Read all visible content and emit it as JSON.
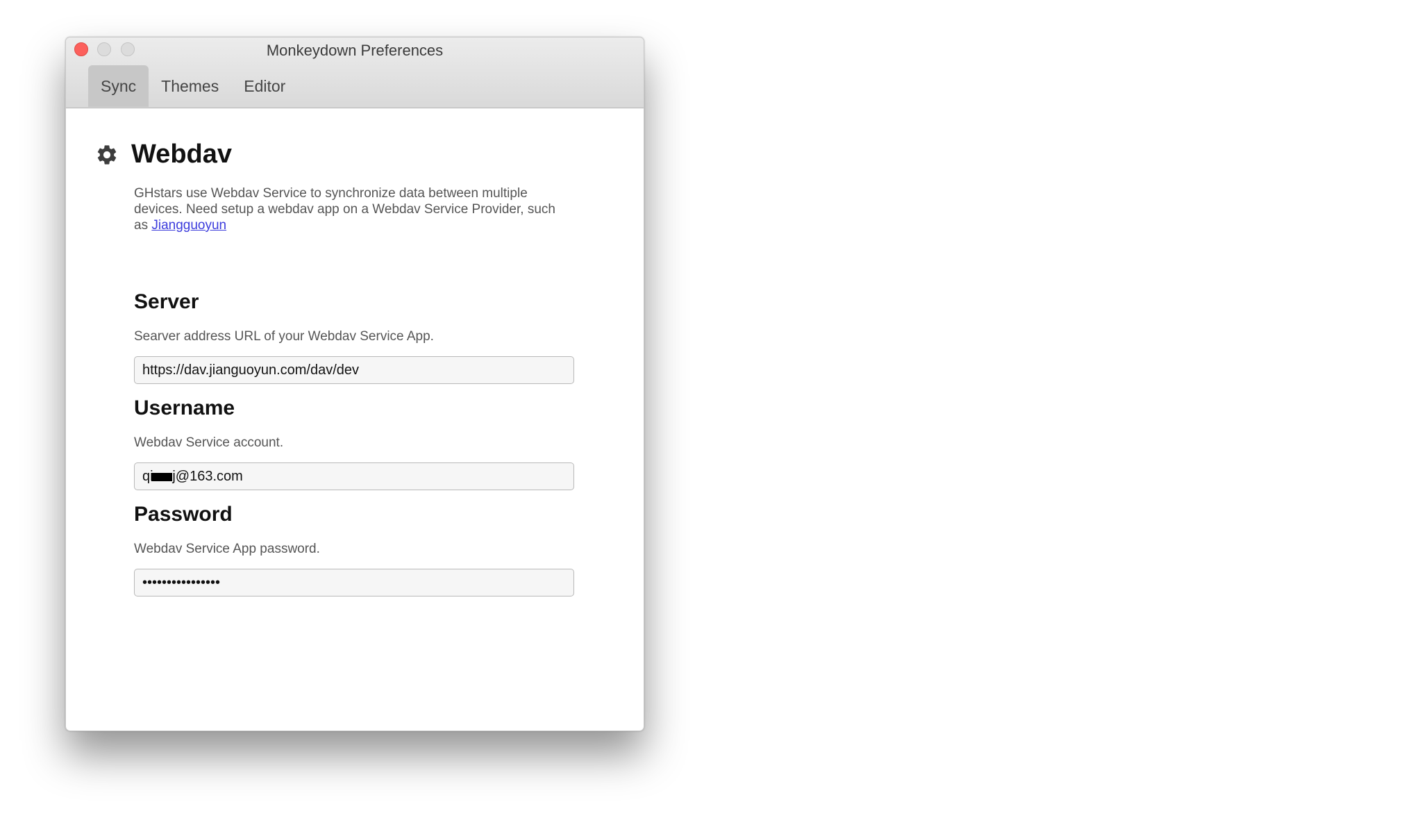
{
  "window": {
    "title": "Monkeydown Preferences"
  },
  "tabs": [
    {
      "label": "Sync",
      "active": true
    },
    {
      "label": "Themes",
      "active": false
    },
    {
      "label": "Editor",
      "active": false
    }
  ],
  "section": {
    "icon": "gear-icon",
    "title": "Webdav",
    "description": "GHstars use Webdav Service to synchronize data between multiple devices. Need setup a webdav app on a Webdav Service Provider, such as",
    "link_text": "Jiangguoyun"
  },
  "server": {
    "title": "Server",
    "help": "Searver address URL of your Webdav Service App.",
    "value": "https://dav.jianguoyun.com/dav/dev"
  },
  "username": {
    "title": "Username",
    "help": "Webdav Service account.",
    "value": "qi     j@163.com"
  },
  "password": {
    "title": "Password",
    "help": "Webdav Service App password.",
    "value": "••••••••••••••••"
  },
  "colors": {
    "close_button": "#fc605c",
    "link": "#3b3bdc",
    "active_tab": "#c7c7c7"
  }
}
